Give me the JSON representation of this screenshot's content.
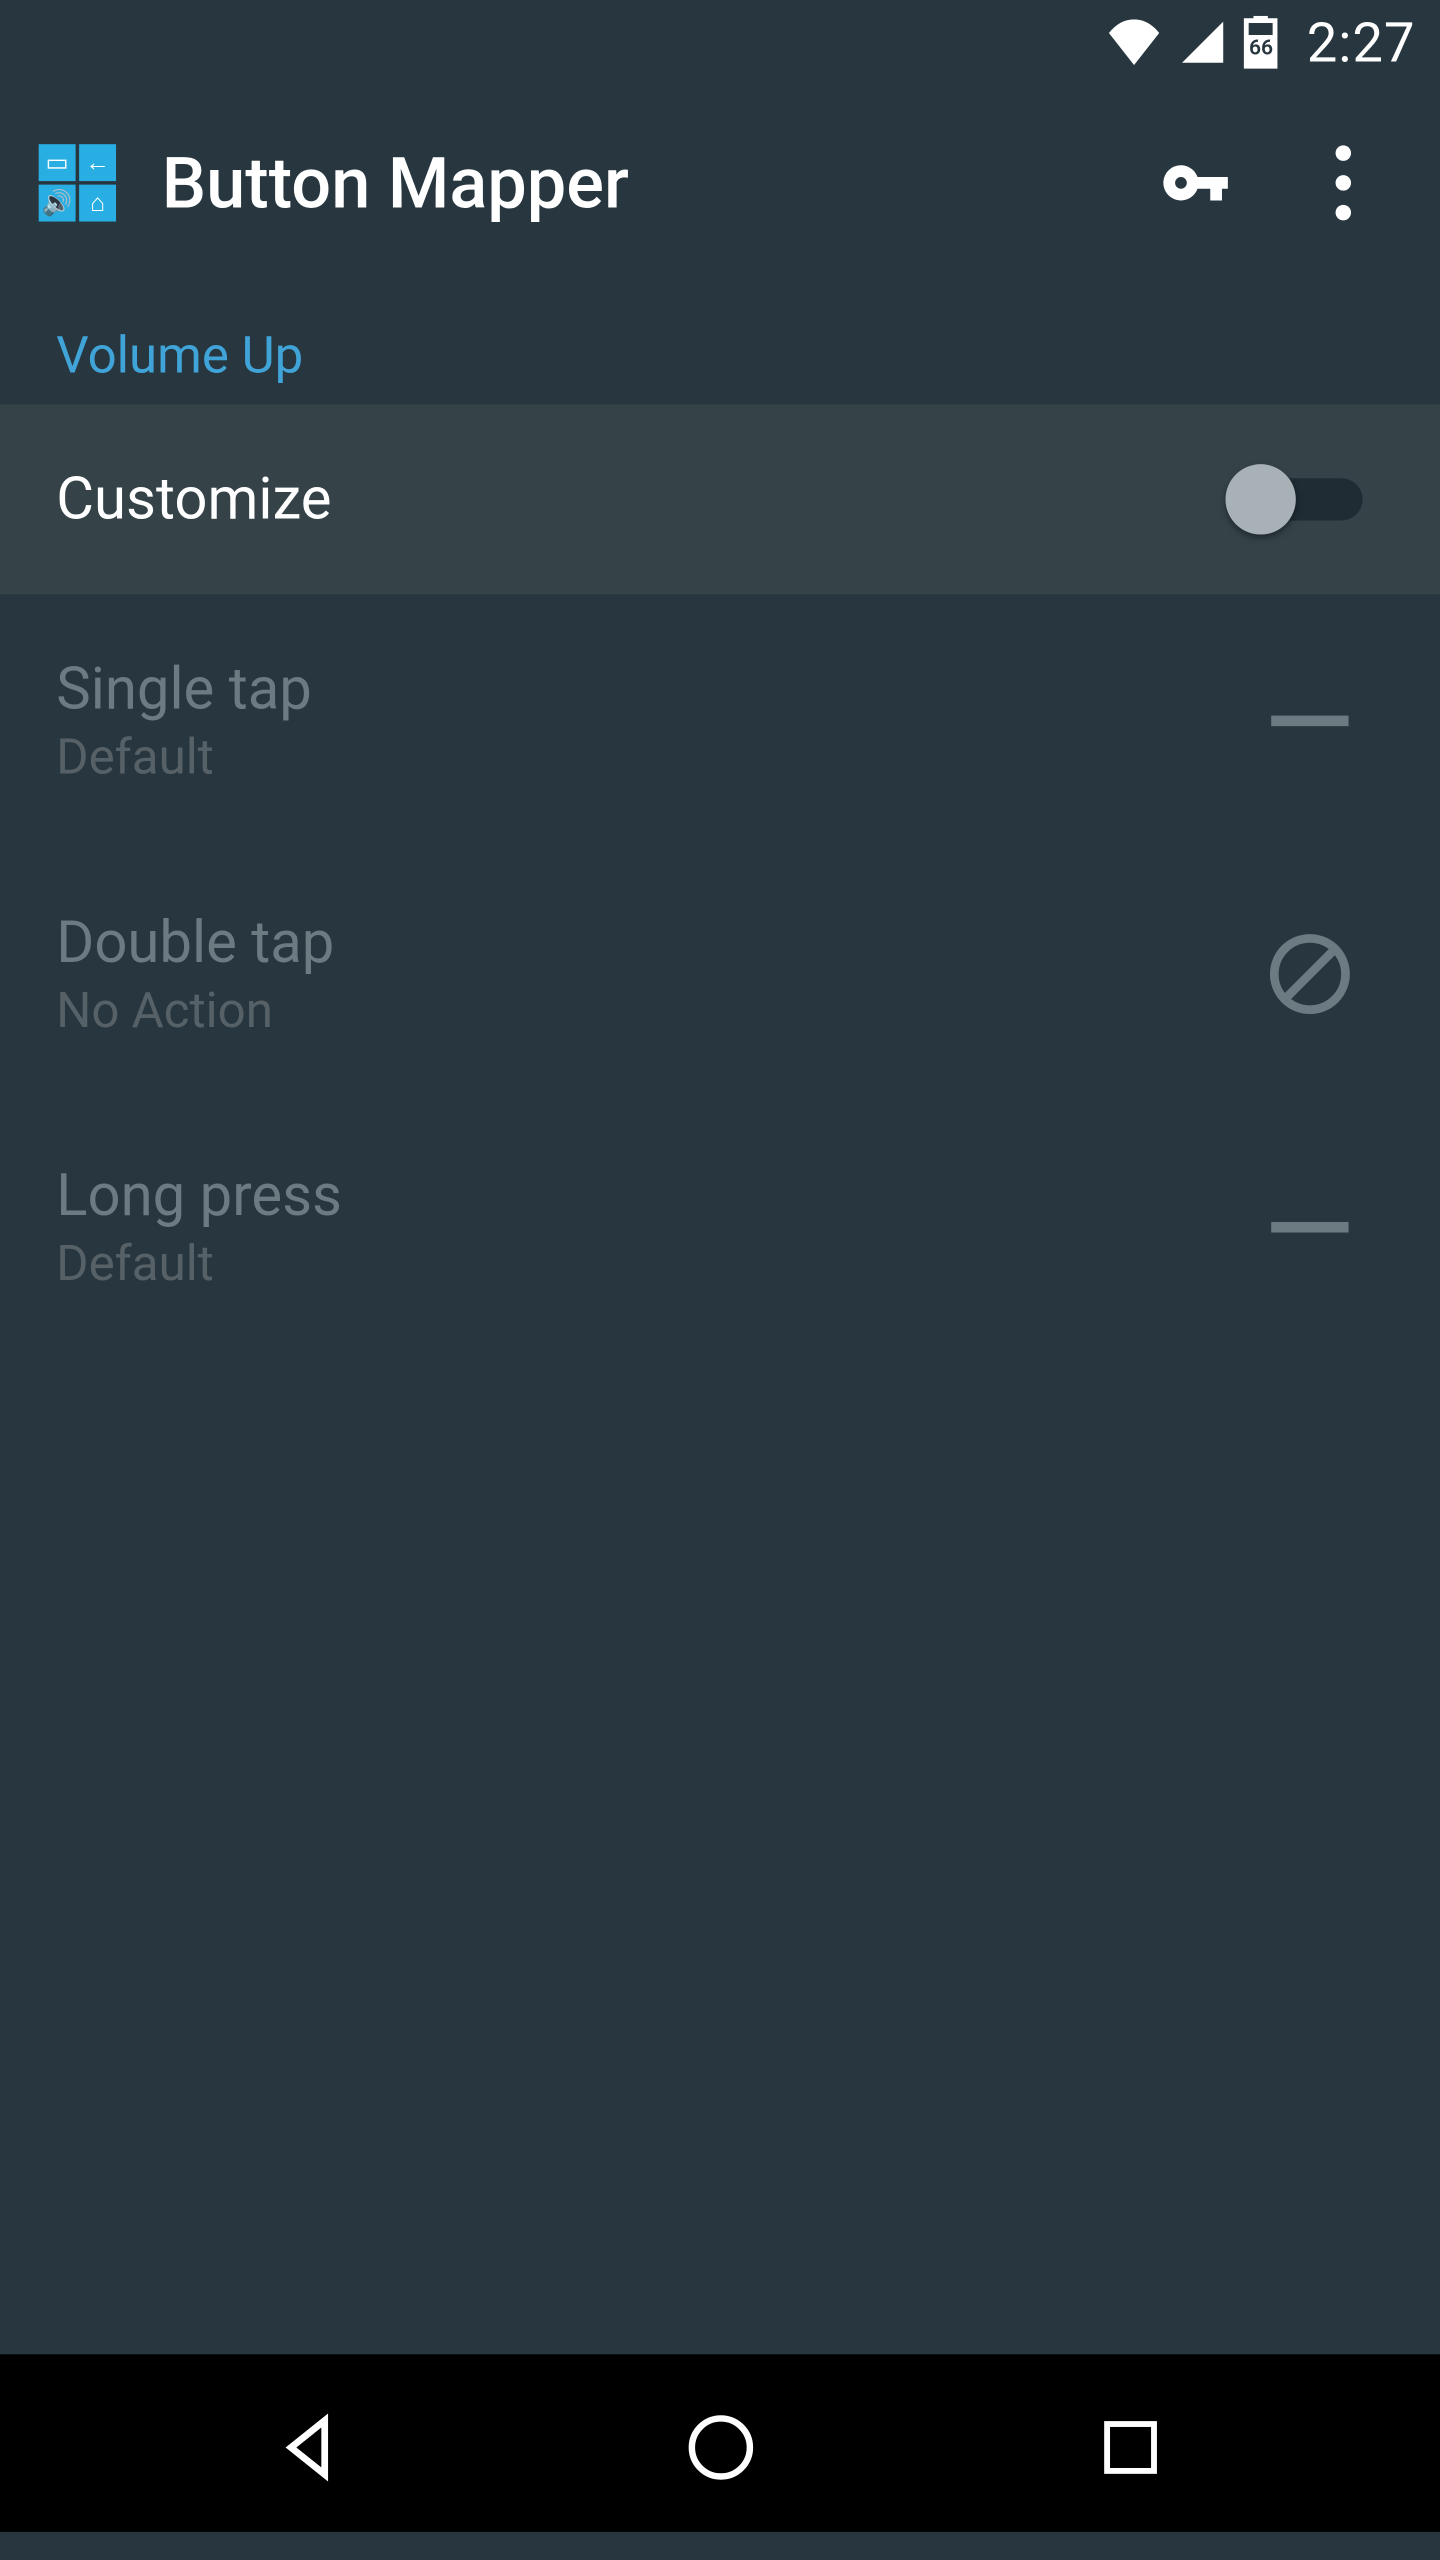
{
  "status": {
    "time": "2:27",
    "battery_pct": "66"
  },
  "appbar": {
    "title": "Button Mapper"
  },
  "section": {
    "header": "Volume Up"
  },
  "rows": {
    "customize": {
      "label": "Customize",
      "toggle_on": false
    },
    "single_tap": {
      "title": "Single tap",
      "sub": "Default",
      "indicator": "dash"
    },
    "double_tap": {
      "title": "Double tap",
      "sub": "No Action",
      "indicator": "no-action"
    },
    "long_press": {
      "title": "Long press",
      "sub": "Default",
      "indicator": "dash"
    }
  },
  "icons": {
    "key": "key-icon",
    "more": "more-vert-icon",
    "wifi": "wifi-icon",
    "signal": "cell-signal-icon",
    "battery": "battery-icon",
    "back": "nav-back-icon",
    "home": "nav-home-icon",
    "recents": "nav-recents-icon",
    "no_action": "no-action-icon"
  }
}
